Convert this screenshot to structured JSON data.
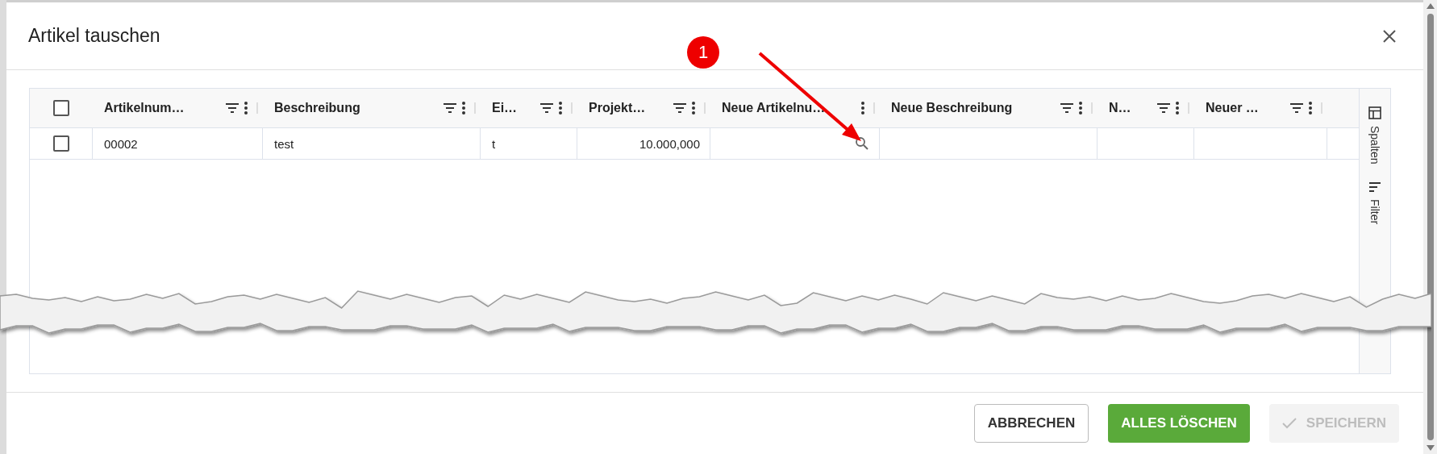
{
  "dialog": {
    "title": "Artikel tauschen"
  },
  "annotation": {
    "label": "1"
  },
  "table": {
    "header_checked": false,
    "columns": [
      {
        "label": "Artikelnum…",
        "kind": "text",
        "filter_icon": true
      },
      {
        "label": "Beschreibung",
        "kind": "text",
        "filter_icon": true
      },
      {
        "label": "Ei…",
        "kind": "text",
        "filter_icon": true
      },
      {
        "label": "Projekt…",
        "kind": "number",
        "filter_icon": true
      },
      {
        "label": "Neue Artikelnu…",
        "kind": "lookup",
        "filter_icon": false
      },
      {
        "label": "Neue Beschreibung",
        "kind": "text",
        "filter_icon": true
      },
      {
        "label": "N…",
        "kind": "text",
        "filter_icon": true
      },
      {
        "label": "Neuer …",
        "kind": "text",
        "filter_icon": true
      }
    ],
    "rows": [
      {
        "checked": false,
        "cells": [
          "00002",
          "test",
          "t",
          "10.000,000",
          "",
          "",
          "",
          ""
        ]
      }
    ]
  },
  "side_panel": [
    {
      "label": "Spalten",
      "kind": "columns"
    },
    {
      "label": "Filter",
      "kind": "filter"
    }
  ],
  "buttons": [
    {
      "label": "ABBRECHEN",
      "kind": "outline",
      "disabled": false
    },
    {
      "label": "ALLES LÖSCHEN",
      "kind": "primary",
      "disabled": false
    },
    {
      "label": "SPEICHERN",
      "kind": "check",
      "disabled": true
    }
  ]
}
